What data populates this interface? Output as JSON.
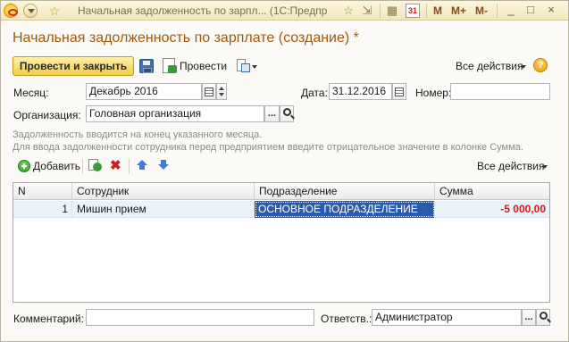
{
  "titlebar": {
    "title": "Начальная задолженность по зарпл... (1С:Предприятие)",
    "m_btn": "M",
    "mplus_btn": "M+",
    "mminus_btn": "M-",
    "min_glyph": "_",
    "max_glyph": "□",
    "close_glyph": "×",
    "calendar_glyph": "31"
  },
  "form": {
    "title": "Начальная задолженность по зарплате (создание) *"
  },
  "toolbar": {
    "post_close_label": "Провести и закрыть",
    "post_label": "Провести",
    "all_actions_label": "Все действия",
    "help_glyph": "?"
  },
  "fields": {
    "month_label": "Месяц:",
    "month_value": "Декабрь 2016",
    "date_label": "Дата:",
    "date_value": "31.12.2016",
    "number_label": "Номер:",
    "number_value": "",
    "org_label": "Организация:",
    "org_value": "Головная организация",
    "choose_glyph": "..."
  },
  "hints": {
    "line1": "Задолженность вводится на конец указанного месяца.",
    "line2": "Для ввода задолженности сотрудника перед предприятием введите отрицательное значение в колонке Сумма."
  },
  "table_toolbar": {
    "add_label": "Добавить",
    "all_actions_label": "Все действия"
  },
  "table": {
    "columns": [
      "N",
      "Сотрудник",
      "Подразделение",
      "Сумма"
    ],
    "rows": [
      {
        "n": "1",
        "employee": "Мишин прием",
        "department": "ОСНОВНОЕ ПОДРАЗДЕЛЕНИЕ",
        "amount": "-5 000,00"
      }
    ]
  },
  "footer": {
    "comment_label": "Комментарий:",
    "comment_value": "",
    "responsible_label": "Ответств.:",
    "responsible_value": "Администратор",
    "choose_glyph": "..."
  }
}
